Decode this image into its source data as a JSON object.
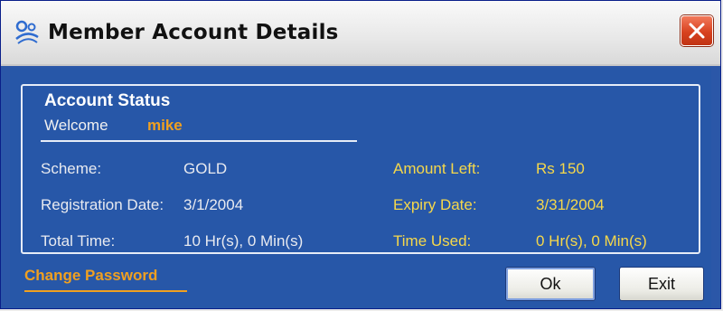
{
  "window": {
    "title": "Member Account Details",
    "icon": "app-logo-icon",
    "close_icon": "close-icon"
  },
  "account_status": {
    "group_title": "Account Status",
    "welcome_label": "Welcome",
    "username": "mike",
    "left_fields": [
      {
        "label": "Scheme:",
        "value": "GOLD"
      },
      {
        "label": "Registration Date:",
        "value": "3/1/2004"
      },
      {
        "label": "Total Time:",
        "value": "10 Hr(s), 0 Min(s)"
      }
    ],
    "right_fields": [
      {
        "label": "Amount Left:",
        "value": "Rs 150"
      },
      {
        "label": "Expiry Date:",
        "value": "3/31/2004"
      },
      {
        "label": "Time Used:",
        "value": "0 Hr(s), 0 Min(s)"
      }
    ]
  },
  "actions": {
    "change_password": "Change Password",
    "ok": "Ok",
    "exit": "Exit"
  },
  "colors": {
    "background": "#2757a8",
    "accent_orange": "#f0a020",
    "label_yellow": "#f6d84a",
    "close_red": "#d8421f"
  }
}
